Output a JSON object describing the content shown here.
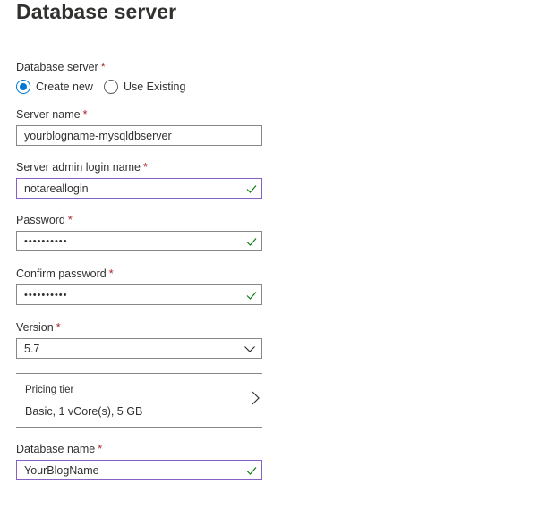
{
  "page": {
    "title": "Database server"
  },
  "server_choice": {
    "label": "Database server",
    "options": [
      {
        "label": "Create new",
        "checked": true
      },
      {
        "label": "Use Existing",
        "checked": false
      }
    ]
  },
  "server_name": {
    "label": "Server name",
    "value": "yourblogname-mysqldbserver"
  },
  "admin_login": {
    "label": "Server admin login name",
    "value": "notareallogin"
  },
  "password": {
    "label": "Password",
    "value": "••••••••••"
  },
  "confirm_password": {
    "label": "Confirm password",
    "value": "••••••••••"
  },
  "version": {
    "label": "Version",
    "value": "5.7"
  },
  "pricing": {
    "label": "Pricing tier",
    "value": "Basic, 1 vCore(s), 5 GB"
  },
  "database_name": {
    "label": "Database name",
    "value": "YourBlogName"
  },
  "required_marker": "*",
  "colors": {
    "accent": "#0078d4",
    "valid_border": "#8661c5",
    "check": "#107c10",
    "required": "#a4262c"
  }
}
